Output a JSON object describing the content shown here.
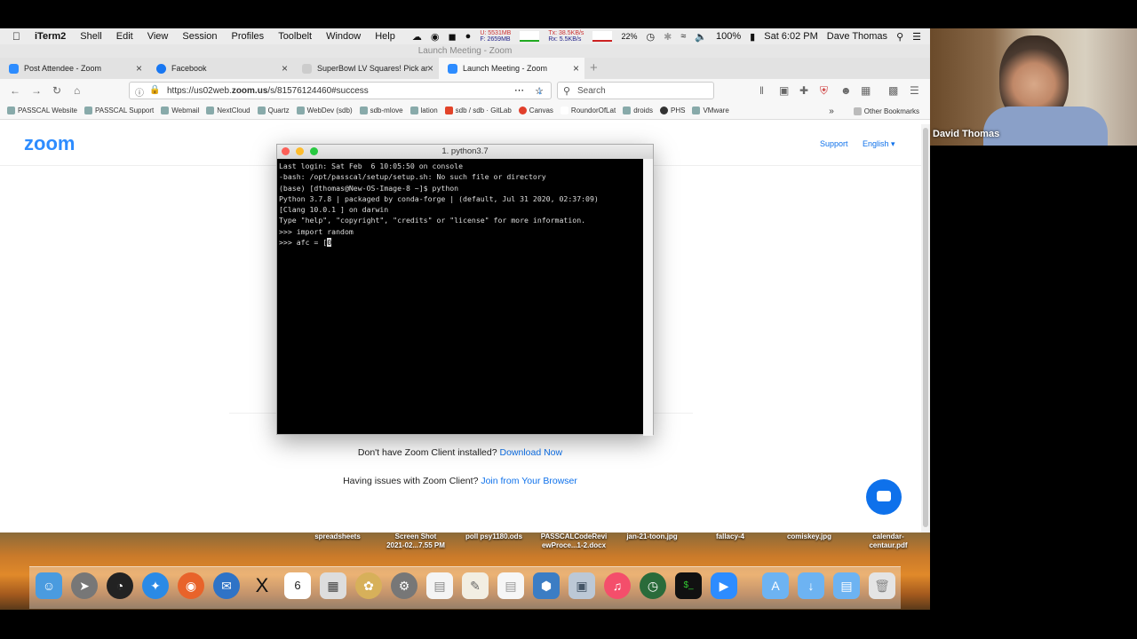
{
  "menubar": {
    "apple": "",
    "app": "iTerm2",
    "items": [
      "Shell",
      "Edit",
      "View",
      "Session",
      "Profiles",
      "Toolbelt",
      "Window",
      "Help"
    ],
    "mem_u": "U: 5531MB",
    "mem_f": "F: 2659MB",
    "net_tx": "Tx: 38.5KB/s",
    "net_rx": "Rx: 5.5KB/s",
    "cpu": "22%",
    "battery": "100%",
    "clock": "Sat 6:02 PM",
    "user": "Dave Thomas"
  },
  "window_title": "Launch Meeting - Zoom",
  "tabs": [
    {
      "label": "Post Attendee - Zoom"
    },
    {
      "label": "Facebook"
    },
    {
      "label": "SuperBowl LV Squares! Pick ar"
    },
    {
      "label": "Launch Meeting - Zoom"
    }
  ],
  "url_prefix": "https://us02web.",
  "url_domain": "zoom.us",
  "url_suffix": "/s/81576124460#success",
  "search_placeholder": "Search",
  "bookmarks": [
    "PASSCAL Website",
    "PASSCAL Support",
    "Webmail",
    "NextCloud",
    "Quartz",
    "WebDev (sdb)",
    "sdb-mlove",
    "lation",
    "sdb / sdb · GitLab",
    "Canvas",
    "RoundorOfLat",
    "droids",
    "PHS",
    "VMware"
  ],
  "other_bookmarks": "Other Bookmarks",
  "page": {
    "logo": "zoom",
    "support": "Support",
    "language": "English ▾",
    "download_text": "Don't have Zoom Client installed?",
    "download_link": "Download Now",
    "browser_text": "Having issues with Zoom Client?",
    "browser_link": "Join from Your Browser"
  },
  "terminal": {
    "title": "1. python3.7",
    "lines": [
      "Last login: Sat Feb  6 10:05:50 on console",
      "-bash: /opt/passcal/setup/setup.sh: No such file or directory",
      "(base) [dthomas@New-OS-Image-8 ~]$ python",
      "Python 3.7.8 | packaged by conda-forge | (default, Jul 31 2020, 02:37:09)",
      "[Clang 10.0.1 ] on darwin",
      "Type \"help\", \"copyright\", \"credits\" or \"license\" for more information.",
      ">>> import random"
    ],
    "current_input": ">>> afc = [",
    "cursor_char": "0"
  },
  "desktop_files": [
    "spreadsheets",
    "Screen Shot\n2021-02...7.55 PM",
    "poll psy1180.ods",
    "PASSCALCodeRevi\newProce...1-2.docx",
    "jan-21-toon.jpg",
    "fallacy-4",
    "comiskey.jpg",
    "calendar-\ncentaur.pdf"
  ],
  "dock_icons": [
    "finder-icon",
    "launchpad-icon",
    "dashboard-icon",
    "safari-icon",
    "firefox-icon",
    "thunderbird-icon",
    "x11-icon",
    "calendar-icon",
    "calculator-icon",
    "paintbrush-icon",
    "system-preferences-icon",
    "document-icon",
    "textedit-icon",
    "pages-icon",
    "virtualbox-icon",
    "preview-icon",
    "music-icon",
    "time-machine-icon",
    "terminal-icon",
    "zoom-icon",
    "applications-folder-icon",
    "downloads-folder-icon",
    "documents-folder-icon",
    "trash-icon"
  ],
  "calendar_day": "6",
  "participant": {
    "name": "David Thomas"
  }
}
